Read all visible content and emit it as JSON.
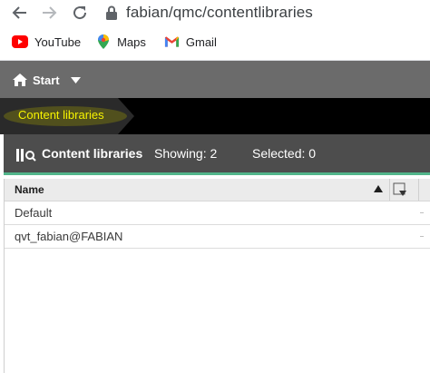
{
  "browser": {
    "url": "fabian/qmc/contentlibraries",
    "bookmarks": [
      {
        "label": "YouTube",
        "icon": "youtube-icon"
      },
      {
        "label": "Maps",
        "icon": "maps-icon"
      },
      {
        "label": "Gmail",
        "icon": "gmail-icon"
      }
    ]
  },
  "header": {
    "start_label": "Start"
  },
  "breadcrumb": {
    "label": "Content libraries"
  },
  "toolbar": {
    "title": "Content libraries",
    "showing": "Showing: 2",
    "selected": "Selected: 0"
  },
  "grid": {
    "columns": [
      "Name"
    ],
    "rows": [
      "Default",
      "qvt_fabian@FABIAN"
    ]
  },
  "colors": {
    "header_bg": "#6b6b6b",
    "crumb_bg": "#000000",
    "crumb_text": "#f6f300",
    "toolbar_bg": "#4d4d4d",
    "accent": "#52b58b"
  }
}
